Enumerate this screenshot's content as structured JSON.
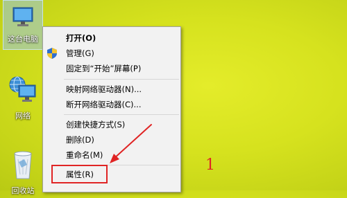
{
  "desktop": {
    "icons": [
      {
        "label": "这台电脑",
        "icon": "computer-icon"
      },
      {
        "label": "网络",
        "icon": "network-icon"
      },
      {
        "label": "回收站",
        "icon": "recycle-bin-icon"
      }
    ]
  },
  "context_menu": {
    "items": [
      {
        "label": "打开(O)",
        "bold": true
      },
      {
        "label": "管理(G)",
        "icon": "uac-shield-icon"
      },
      {
        "label": "固定到“开始”屏幕(P)"
      },
      {
        "label": "映射网络驱动器(N)..."
      },
      {
        "label": "断开网络驱动器(C)..."
      },
      {
        "label": "创建快捷方式(S)"
      },
      {
        "label": "删除(D)"
      },
      {
        "label": "重命名(M)"
      },
      {
        "label": "属性(R)",
        "highlighted": true
      }
    ]
  },
  "annotation": {
    "number": "1",
    "color": "#e02424"
  },
  "colors": {
    "desktop_background": "#d6e21e",
    "menu_background": "#f2f2f2",
    "annotation_red": "#e02424"
  }
}
